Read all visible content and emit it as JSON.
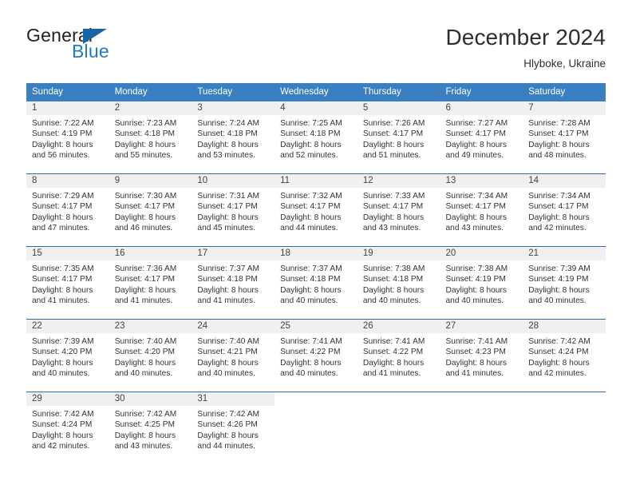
{
  "brand": {
    "name_part1": "General",
    "name_part2": "Blue",
    "flag_icon": "blue-triangle-flag-icon"
  },
  "header": {
    "title": "December 2024",
    "subtitle": "Hlyboke, Ukraine"
  },
  "colors": {
    "header_blue": "#3a7fc1",
    "row_divider_blue": "#2f6fae",
    "daynum_band": "#f0f0f0",
    "brand_blue": "#1f7ac4",
    "text": "#333333"
  },
  "weekdays": [
    "Sunday",
    "Monday",
    "Tuesday",
    "Wednesday",
    "Thursday",
    "Friday",
    "Saturday"
  ],
  "weeks": [
    [
      {
        "day": "1",
        "sunrise": "Sunrise: 7:22 AM",
        "sunset": "Sunset: 4:19 PM",
        "daylight1": "Daylight: 8 hours",
        "daylight2": "and 56 minutes."
      },
      {
        "day": "2",
        "sunrise": "Sunrise: 7:23 AM",
        "sunset": "Sunset: 4:18 PM",
        "daylight1": "Daylight: 8 hours",
        "daylight2": "and 55 minutes."
      },
      {
        "day": "3",
        "sunrise": "Sunrise: 7:24 AM",
        "sunset": "Sunset: 4:18 PM",
        "daylight1": "Daylight: 8 hours",
        "daylight2": "and 53 minutes."
      },
      {
        "day": "4",
        "sunrise": "Sunrise: 7:25 AM",
        "sunset": "Sunset: 4:18 PM",
        "daylight1": "Daylight: 8 hours",
        "daylight2": "and 52 minutes."
      },
      {
        "day": "5",
        "sunrise": "Sunrise: 7:26 AM",
        "sunset": "Sunset: 4:17 PM",
        "daylight1": "Daylight: 8 hours",
        "daylight2": "and 51 minutes."
      },
      {
        "day": "6",
        "sunrise": "Sunrise: 7:27 AM",
        "sunset": "Sunset: 4:17 PM",
        "daylight1": "Daylight: 8 hours",
        "daylight2": "and 49 minutes."
      },
      {
        "day": "7",
        "sunrise": "Sunrise: 7:28 AM",
        "sunset": "Sunset: 4:17 PM",
        "daylight1": "Daylight: 8 hours",
        "daylight2": "and 48 minutes."
      }
    ],
    [
      {
        "day": "8",
        "sunrise": "Sunrise: 7:29 AM",
        "sunset": "Sunset: 4:17 PM",
        "daylight1": "Daylight: 8 hours",
        "daylight2": "and 47 minutes."
      },
      {
        "day": "9",
        "sunrise": "Sunrise: 7:30 AM",
        "sunset": "Sunset: 4:17 PM",
        "daylight1": "Daylight: 8 hours",
        "daylight2": "and 46 minutes."
      },
      {
        "day": "10",
        "sunrise": "Sunrise: 7:31 AM",
        "sunset": "Sunset: 4:17 PM",
        "daylight1": "Daylight: 8 hours",
        "daylight2": "and 45 minutes."
      },
      {
        "day": "11",
        "sunrise": "Sunrise: 7:32 AM",
        "sunset": "Sunset: 4:17 PM",
        "daylight1": "Daylight: 8 hours",
        "daylight2": "and 44 minutes."
      },
      {
        "day": "12",
        "sunrise": "Sunrise: 7:33 AM",
        "sunset": "Sunset: 4:17 PM",
        "daylight1": "Daylight: 8 hours",
        "daylight2": "and 43 minutes."
      },
      {
        "day": "13",
        "sunrise": "Sunrise: 7:34 AM",
        "sunset": "Sunset: 4:17 PM",
        "daylight1": "Daylight: 8 hours",
        "daylight2": "and 43 minutes."
      },
      {
        "day": "14",
        "sunrise": "Sunrise: 7:34 AM",
        "sunset": "Sunset: 4:17 PM",
        "daylight1": "Daylight: 8 hours",
        "daylight2": "and 42 minutes."
      }
    ],
    [
      {
        "day": "15",
        "sunrise": "Sunrise: 7:35 AM",
        "sunset": "Sunset: 4:17 PM",
        "daylight1": "Daylight: 8 hours",
        "daylight2": "and 41 minutes."
      },
      {
        "day": "16",
        "sunrise": "Sunrise: 7:36 AM",
        "sunset": "Sunset: 4:17 PM",
        "daylight1": "Daylight: 8 hours",
        "daylight2": "and 41 minutes."
      },
      {
        "day": "17",
        "sunrise": "Sunrise: 7:37 AM",
        "sunset": "Sunset: 4:18 PM",
        "daylight1": "Daylight: 8 hours",
        "daylight2": "and 41 minutes."
      },
      {
        "day": "18",
        "sunrise": "Sunrise: 7:37 AM",
        "sunset": "Sunset: 4:18 PM",
        "daylight1": "Daylight: 8 hours",
        "daylight2": "and 40 minutes."
      },
      {
        "day": "19",
        "sunrise": "Sunrise: 7:38 AM",
        "sunset": "Sunset: 4:18 PM",
        "daylight1": "Daylight: 8 hours",
        "daylight2": "and 40 minutes."
      },
      {
        "day": "20",
        "sunrise": "Sunrise: 7:38 AM",
        "sunset": "Sunset: 4:19 PM",
        "daylight1": "Daylight: 8 hours",
        "daylight2": "and 40 minutes."
      },
      {
        "day": "21",
        "sunrise": "Sunrise: 7:39 AM",
        "sunset": "Sunset: 4:19 PM",
        "daylight1": "Daylight: 8 hours",
        "daylight2": "and 40 minutes."
      }
    ],
    [
      {
        "day": "22",
        "sunrise": "Sunrise: 7:39 AM",
        "sunset": "Sunset: 4:20 PM",
        "daylight1": "Daylight: 8 hours",
        "daylight2": "and 40 minutes."
      },
      {
        "day": "23",
        "sunrise": "Sunrise: 7:40 AM",
        "sunset": "Sunset: 4:20 PM",
        "daylight1": "Daylight: 8 hours",
        "daylight2": "and 40 minutes."
      },
      {
        "day": "24",
        "sunrise": "Sunrise: 7:40 AM",
        "sunset": "Sunset: 4:21 PM",
        "daylight1": "Daylight: 8 hours",
        "daylight2": "and 40 minutes."
      },
      {
        "day": "25",
        "sunrise": "Sunrise: 7:41 AM",
        "sunset": "Sunset: 4:22 PM",
        "daylight1": "Daylight: 8 hours",
        "daylight2": "and 40 minutes."
      },
      {
        "day": "26",
        "sunrise": "Sunrise: 7:41 AM",
        "sunset": "Sunset: 4:22 PM",
        "daylight1": "Daylight: 8 hours",
        "daylight2": "and 41 minutes."
      },
      {
        "day": "27",
        "sunrise": "Sunrise: 7:41 AM",
        "sunset": "Sunset: 4:23 PM",
        "daylight1": "Daylight: 8 hours",
        "daylight2": "and 41 minutes."
      },
      {
        "day": "28",
        "sunrise": "Sunrise: 7:42 AM",
        "sunset": "Sunset: 4:24 PM",
        "daylight1": "Daylight: 8 hours",
        "daylight2": "and 42 minutes."
      }
    ],
    [
      {
        "day": "29",
        "sunrise": "Sunrise: 7:42 AM",
        "sunset": "Sunset: 4:24 PM",
        "daylight1": "Daylight: 8 hours",
        "daylight2": "and 42 minutes."
      },
      {
        "day": "30",
        "sunrise": "Sunrise: 7:42 AM",
        "sunset": "Sunset: 4:25 PM",
        "daylight1": "Daylight: 8 hours",
        "daylight2": "and 43 minutes."
      },
      {
        "day": "31",
        "sunrise": "Sunrise: 7:42 AM",
        "sunset": "Sunset: 4:26 PM",
        "daylight1": "Daylight: 8 hours",
        "daylight2": "and 44 minutes."
      },
      {
        "day": "",
        "sunrise": "",
        "sunset": "",
        "daylight1": "",
        "daylight2": ""
      },
      {
        "day": "",
        "sunrise": "",
        "sunset": "",
        "daylight1": "",
        "daylight2": ""
      },
      {
        "day": "",
        "sunrise": "",
        "sunset": "",
        "daylight1": "",
        "daylight2": ""
      },
      {
        "day": "",
        "sunrise": "",
        "sunset": "",
        "daylight1": "",
        "daylight2": ""
      }
    ]
  ]
}
